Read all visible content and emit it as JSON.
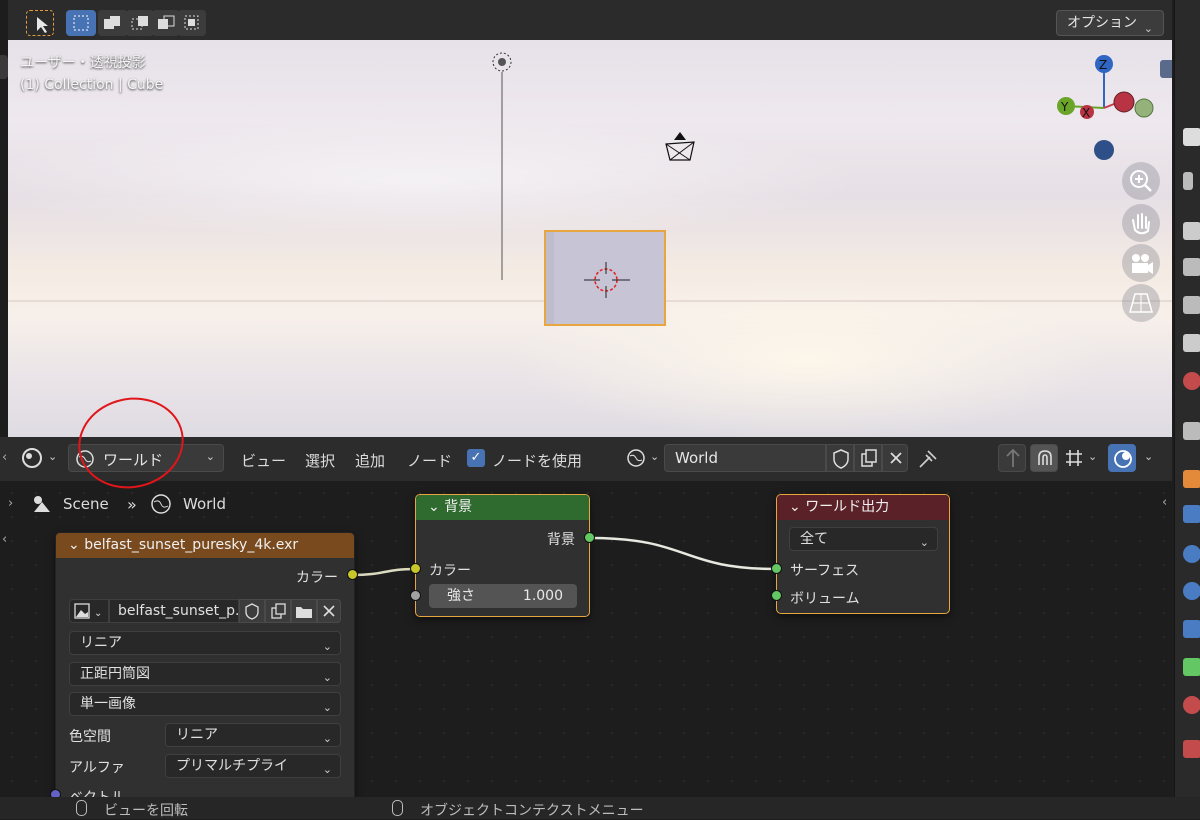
{
  "viewport": {
    "view_label": "ユーザー・透視投影",
    "collection_label": "(1) Collection | Cube",
    "options_button": "オプション",
    "gizmo_axes": {
      "z": "Z",
      "y": "Y",
      "x": "X"
    }
  },
  "node_header": {
    "editor_type": "ワールド",
    "menus": [
      "ビュー",
      "選択",
      "追加",
      "ノード"
    ],
    "use_nodes_label": "ノードを使用",
    "use_nodes_checked": true,
    "world_name": "World"
  },
  "breadcrumb": {
    "scene": "Scene",
    "world": "World"
  },
  "nodes": {
    "image_texture": {
      "title": "belfast_sunset_puresky_4k.exr",
      "output_color": "カラー",
      "image_name": "belfast_sunset_p...",
      "interpolation": "リニア",
      "projection": "正距円筒図",
      "source": "単一画像",
      "color_space_label": "色空間",
      "color_space_value": "リニア",
      "alpha_label": "アルファ",
      "alpha_value": "プリマルチプライ",
      "vector_label": "ベクトル"
    },
    "background": {
      "title": "背景",
      "output": "背景",
      "input_color": "カラー",
      "strength_label": "強さ",
      "strength_value": "1.000"
    },
    "world_output": {
      "title": "ワールド出力",
      "target": "全て",
      "surface": "サーフェス",
      "volume": "ボリューム"
    }
  },
  "statusbar": {
    "left_hint": "ビューを回転",
    "right_hint": "オブジェクトコンテクストメニュー"
  },
  "colors": {
    "selection_blue": "#4772b3",
    "texture_header": "#7a4a1f",
    "shader_header": "#2f6a2f",
    "output_header": "#5a2228",
    "color_socket": "#c7c729",
    "shader_socket": "#63c763",
    "gray_socket": "#a1a1a1",
    "vector_socket": "#6363c7",
    "annotation_red": "#e0161b",
    "selected_outline": "#e7a640"
  }
}
